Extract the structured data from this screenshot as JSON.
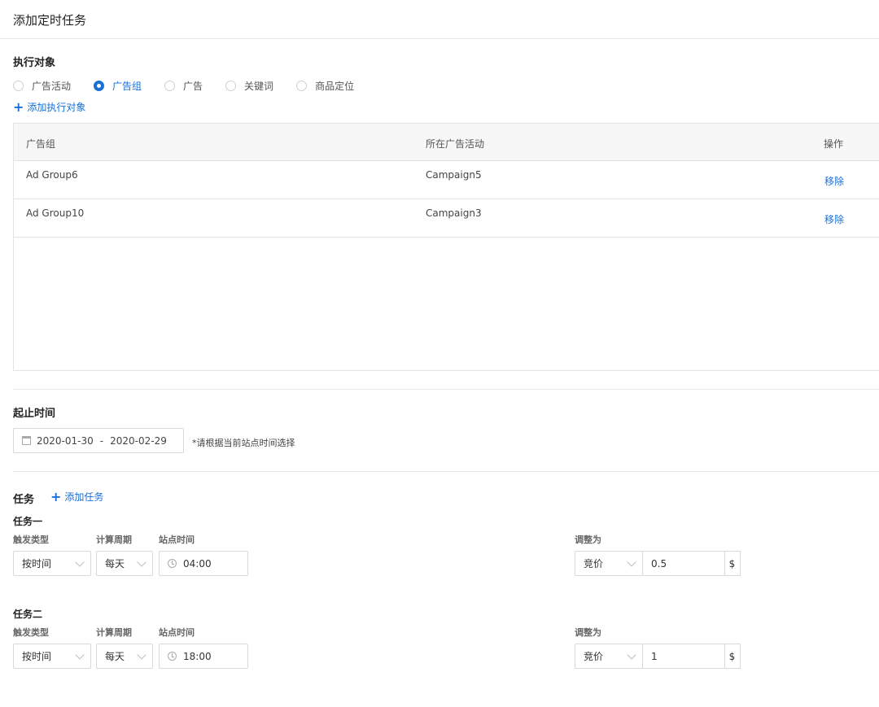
{
  "header": {
    "title": "添加定时任务"
  },
  "target_section": {
    "title": "执行对象",
    "radios": [
      {
        "label": "广告活动",
        "checked": false
      },
      {
        "label": "广告组",
        "checked": true
      },
      {
        "label": "广告",
        "checked": false
      },
      {
        "label": "关键词",
        "checked": false
      },
      {
        "label": "商品定位",
        "checked": false
      }
    ],
    "add_label": "添加执行对象"
  },
  "table": {
    "headers": [
      "广告组",
      "所在广告活动",
      "操作"
    ],
    "rows": [
      {
        "group": "Ad Group6",
        "campaign": "Campaign5",
        "action": "移除"
      },
      {
        "group": "Ad Group10",
        "campaign": "Campaign3",
        "action": "移除"
      }
    ]
  },
  "period_section": {
    "title": "起止时间",
    "start": "2020-01-30",
    "separator": "-",
    "end": "2020-02-29",
    "hint": "*请根据当前站点时间选择"
  },
  "tasks_section": {
    "title": "任务",
    "add_label": "添加任务",
    "labels": {
      "trigger": "触发类型",
      "cycle": "计算周期",
      "site_time": "站点时间",
      "adjust": "调整为"
    },
    "tasks": [
      {
        "name": "任务一",
        "trigger": "按时间",
        "cycle": "每天",
        "time": "04:00",
        "adjust_type": "竞价",
        "value": "0.5",
        "unit": "$"
      },
      {
        "name": "任务二",
        "trigger": "按时间",
        "cycle": "每天",
        "time": "18:00",
        "adjust_type": "竞价",
        "value": "1",
        "unit": "$"
      }
    ]
  },
  "colors": {
    "accent": "#1a6fd6",
    "border": "#d9d9d9"
  }
}
